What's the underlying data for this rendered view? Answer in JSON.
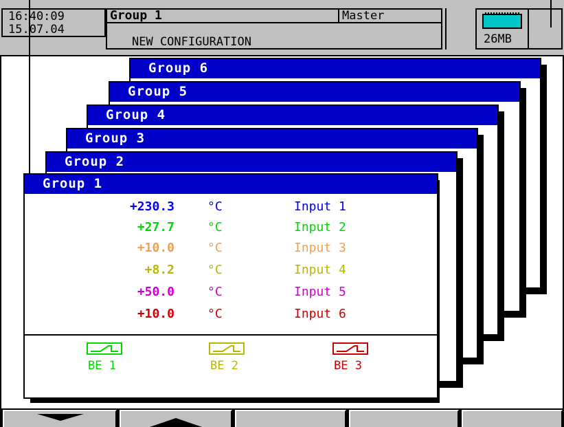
{
  "header": {
    "time": "16:40:09",
    "date": "15.07.04",
    "group_title": "Group 1",
    "mode": "Master",
    "status_message": "NEW CONFIGURATION",
    "memory": "26MB"
  },
  "groups": {
    "g6": "Group 6",
    "g5": "Group 5",
    "g4": "Group 4",
    "g3": "Group 3",
    "g2": "Group 2",
    "g1": "Group 1"
  },
  "channels": [
    {
      "value": "+230.3",
      "unit": "°C",
      "label": "Input 1",
      "color": "#0000ff"
    },
    {
      "value": "+27.7",
      "unit": "°C",
      "label": "Input 2",
      "color": "#00d800"
    },
    {
      "value": "+10.0",
      "unit": "°C",
      "label": "Input 3",
      "color": "#f0a050"
    },
    {
      "value": "+8.2",
      "unit": "°C",
      "label": "Input 4",
      "color": "#b8b800"
    },
    {
      "value": "+50.0",
      "unit": "°C",
      "label": "Input 5",
      "color": "#d000d0"
    },
    {
      "value": "+10.0",
      "unit": "°C",
      "label": "Input 6",
      "color": "#d00000"
    }
  ],
  "relays": [
    {
      "label": "BE 1",
      "color": "#00d800"
    },
    {
      "label": "BE 2",
      "color": "#b8b800"
    },
    {
      "label": "BE 3",
      "color": "#d00000"
    }
  ],
  "softkeys": {
    "k1_icon": "arrow-down-icon",
    "k2_icon": "arrow-up-icon"
  },
  "colors": {
    "group_header": "#0000c8",
    "panel_gray": "#c0c0c0",
    "battery": "#00c8c8"
  }
}
